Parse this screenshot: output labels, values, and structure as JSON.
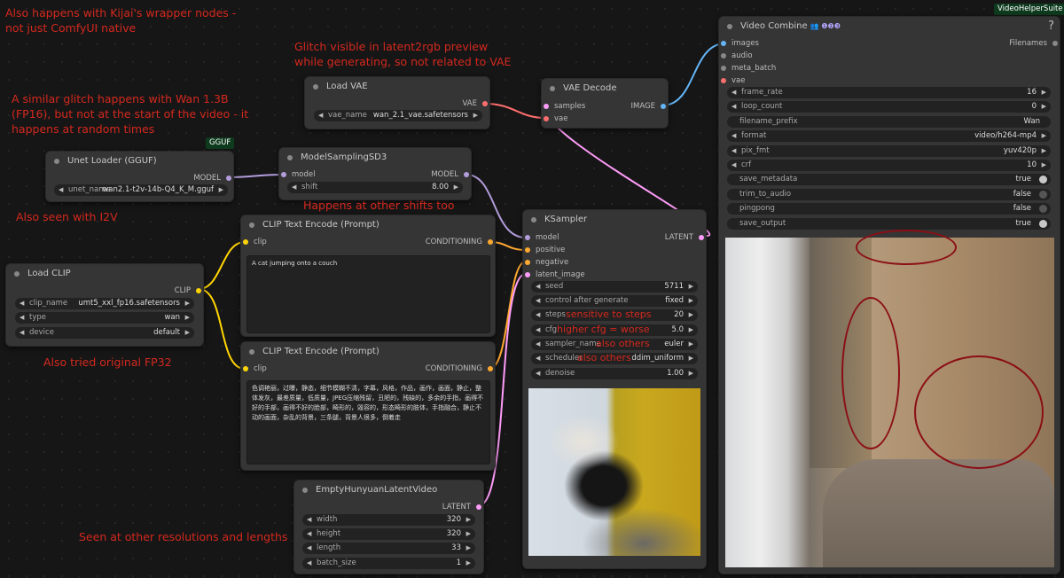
{
  "colors": {
    "model": "#b39ddb",
    "clip": "#ffd500",
    "conditioning": "#ffa931",
    "vae": "#ff6e6e",
    "latent": "#ff9cf9",
    "image": "#64b5f6",
    "annotation": "#d4281e",
    "widget_bg": "#222222",
    "node_bg": "#353535"
  },
  "badges": {
    "gguf": "GGUF",
    "vhs": "VideoHelperSuite"
  },
  "annotations": {
    "a1_l1": "Also happens with Kijai's wrapper nodes -",
    "a1_l2": "not just ComfyUI native",
    "a2_l1": "Glitch visible in latent2rgb preview",
    "a2_l2": "while generating, so not related to VAE",
    "a3_l1": "A similar glitch happens with Wan 1.3B",
    "a3_l2": "(FP16), but not at the start of the video - it",
    "a3_l3": "happens at random times",
    "a4": "Also seen with I2V",
    "a5": "Happens at other shifts too",
    "a6": "Also tried original FP32",
    "a7": "Seen at other resolutions and lengths",
    "a8": "sensitive to steps",
    "a9": "higher cfg = worse",
    "a10": "also others",
    "a11": "also others"
  },
  "nodes": {
    "load_vae": {
      "title": "Load VAE",
      "out": "VAE",
      "w_label": "vae_name",
      "w_value": "wan_2.1_vae.safetensors"
    },
    "vae_decode": {
      "title": "VAE Decode",
      "in1": "samples",
      "in2": "vae",
      "out": "IMAGE"
    },
    "unet": {
      "title": "Unet Loader (GGUF)",
      "out": "MODEL",
      "w_label": "unet_name",
      "w_value": "wan2.1-t2v-14b-Q4_K_M.gguf"
    },
    "sampling": {
      "title": "ModelSamplingSD3",
      "in1": "model",
      "out": "MODEL",
      "w_label": "shift",
      "w_value": "8.00"
    },
    "load_clip": {
      "title": "Load CLIP",
      "out": "CLIP",
      "widgets": [
        {
          "label": "clip_name",
          "value": "umt5_xxl_fp16.safetensors"
        },
        {
          "label": "type",
          "value": "wan"
        },
        {
          "label": "device",
          "value": "default"
        }
      ]
    },
    "clip_pos": {
      "title": "CLIP Text Encode (Prompt)",
      "in1": "clip",
      "out": "CONDITIONING",
      "text": "A cat jumping onto a couch"
    },
    "clip_neg": {
      "title": "CLIP Text Encode (Prompt)",
      "in1": "clip",
      "out": "CONDITIONING",
      "text": "色调艳丽，过曝，静态，细节模糊不清，字幕，风格，作品，画作，画面，静止，整体发灰，最差质量，低质量，JPEG压缩残留，丑陋的，残缺的，多余的手指，画得不好的手部，画得不好的脸部，畸形的，毁容的，形态畸形的肢体，手指融合，静止不动的画面，杂乱的背景，三条腿，背景人很多，倒着走"
    },
    "ksampler": {
      "title": "KSampler",
      "in1": "model",
      "in2": "positive",
      "in3": "negative",
      "in4": "latent_image",
      "out": "LATENT",
      "widgets": [
        {
          "label": "seed",
          "value": "5711"
        },
        {
          "label": "control after generate",
          "value": "fixed"
        },
        {
          "label": "steps",
          "value": "20"
        },
        {
          "label": "cfg",
          "value": "5.0"
        },
        {
          "label": "sampler_name",
          "value": "euler"
        },
        {
          "label": "scheduler",
          "value": "ddim_uniform"
        },
        {
          "label": "denoise",
          "value": "1.00"
        }
      ]
    },
    "empty_latent": {
      "title": "EmptyHunyuanLatentVideo",
      "out": "LATENT",
      "widgets": [
        {
          "label": "width",
          "value": "320"
        },
        {
          "label": "height",
          "value": "320"
        },
        {
          "label": "length",
          "value": "33"
        },
        {
          "label": "batch_size",
          "value": "1"
        }
      ]
    },
    "video_combine": {
      "title": "Video Combine",
      "title_icons": "👥 ❶❷❸",
      "help": "?",
      "in1": "images",
      "in2": "audio",
      "in3": "meta_batch",
      "in4": "vae",
      "out": "Filenames",
      "widgets": [
        {
          "label": "frame_rate",
          "value": "16",
          "type": "number"
        },
        {
          "label": "loop_count",
          "value": "0",
          "type": "number"
        },
        {
          "label": "filename_prefix",
          "value": "Wan",
          "type": "text"
        },
        {
          "label": "format",
          "value": "video/h264-mp4",
          "type": "combo"
        },
        {
          "label": "pix_fmt",
          "value": "yuv420p",
          "type": "combo"
        },
        {
          "label": "crf",
          "value": "10",
          "type": "number"
        },
        {
          "label": "save_metadata",
          "value": "true",
          "type": "toggle"
        },
        {
          "label": "trim_to_audio",
          "value": "false",
          "type": "toggle"
        },
        {
          "label": "pingpong",
          "value": "false",
          "type": "toggle"
        },
        {
          "label": "save_output",
          "value": "true",
          "type": "toggle"
        }
      ]
    }
  }
}
